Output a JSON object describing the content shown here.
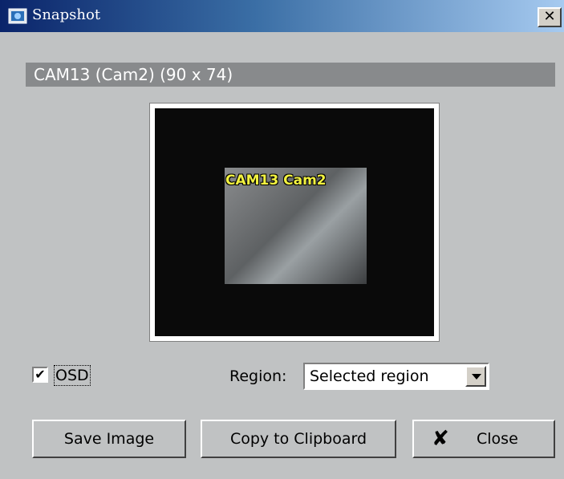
{
  "window": {
    "title": "Snapshot",
    "close_symbol": "✕"
  },
  "camera": {
    "header": "CAM13 (Cam2) (90 x 74)",
    "osd_overlay": "CAM13 Cam2"
  },
  "options": {
    "osd_label": "OSD",
    "osd_checked": true,
    "osd_check_glyph": "✔",
    "region_label": "Region:",
    "region_value": "Selected region"
  },
  "buttons": {
    "save": "Save Image",
    "copy": "Copy to Clipboard",
    "close": "Close",
    "close_icon": "✘"
  },
  "icons": {
    "app": "camera-snapshot-icon",
    "close": "close-icon",
    "dropdown": "chevron-down-icon"
  }
}
